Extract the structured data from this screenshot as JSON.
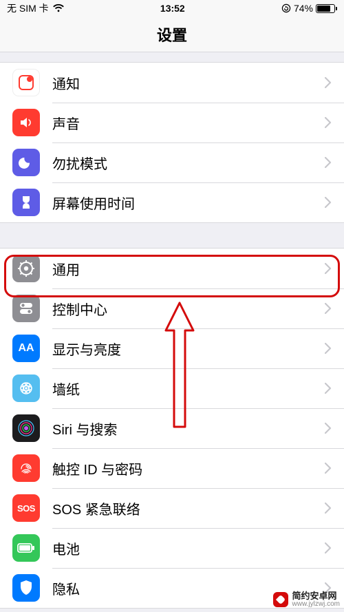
{
  "status": {
    "carrier": "无 SIM 卡",
    "time": "13:52",
    "battery_pct": "74%"
  },
  "title": "设置",
  "groups": [
    {
      "rows": [
        {
          "key": "notifications",
          "label": "通知"
        },
        {
          "key": "sounds",
          "label": "声音"
        },
        {
          "key": "dnd",
          "label": "勿扰模式"
        },
        {
          "key": "screentime",
          "label": "屏幕使用时间"
        }
      ]
    },
    {
      "rows": [
        {
          "key": "general",
          "label": "通用"
        },
        {
          "key": "control",
          "label": "控制中心"
        },
        {
          "key": "display",
          "label": "显示与亮度"
        },
        {
          "key": "wallpaper",
          "label": "墙纸"
        },
        {
          "key": "siri",
          "label": "Siri 与搜索"
        },
        {
          "key": "touchid",
          "label": "触控 ID 与密码"
        },
        {
          "key": "sos",
          "label": "SOS 紧急联络"
        },
        {
          "key": "battery",
          "label": "电池"
        },
        {
          "key": "privacy",
          "label": "隐私"
        }
      ]
    }
  ],
  "sos_text": "SOS",
  "display_text": "AA",
  "watermark": {
    "line1": "简约安卓网",
    "line2": "www.jylzwj.com"
  }
}
